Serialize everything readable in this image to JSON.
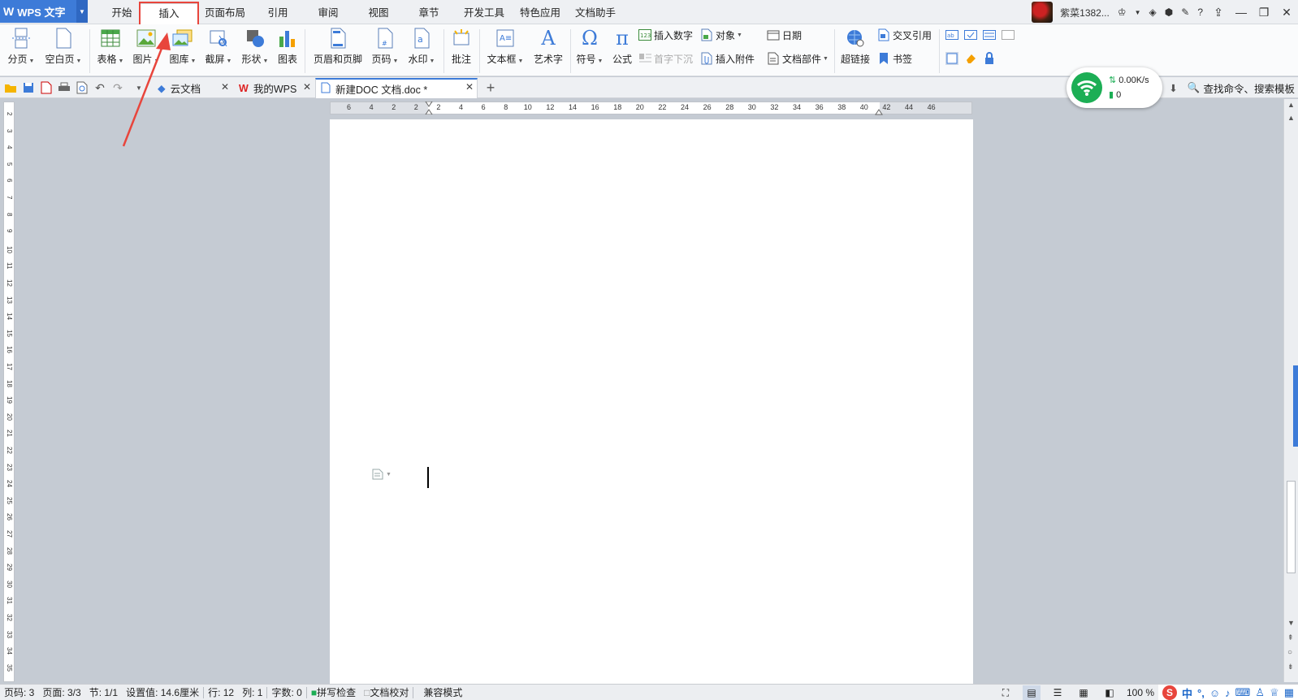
{
  "app": {
    "title": "WPS 文字",
    "logo": "W"
  },
  "menu": {
    "tabs": [
      "开始",
      "插入",
      "页面布局",
      "引用",
      "审阅",
      "视图",
      "章节",
      "开发工具",
      "特色应用",
      "文档助手"
    ],
    "active_tab": "插入"
  },
  "user": {
    "name": "紫菜1382..."
  },
  "ribbon": {
    "page_break": "分页",
    "blank_page": "空白页",
    "table": "表格",
    "picture": "图片",
    "gallery": "图库",
    "screenshot": "截屏",
    "shape": "形状",
    "chart": "图表",
    "header_footer": "页眉和页脚",
    "page_number": "页码",
    "watermark": "水印",
    "comment": "批注",
    "textbox": "文本框",
    "wordart": "艺术字",
    "symbol": "符号",
    "formula": "公式",
    "insert_number": "插入数字",
    "drop_cap": "首字下沉",
    "object": "对象",
    "attachment": "插入附件",
    "date": "日期",
    "doc_parts": "文档部件",
    "hyperlink": "超链接",
    "cross_ref": "交叉引用",
    "bookmark": "书签"
  },
  "doc_tabs": {
    "cloud": "云文档",
    "mywps": "我的WPS",
    "current": "新建DOC 文档.doc *"
  },
  "search": {
    "label": "查找命令、搜索模板"
  },
  "network": {
    "speed": "0.00K/s",
    "count": "0"
  },
  "ruler": {
    "h_marks": [
      "6",
      "4",
      "2",
      "2",
      "2",
      "4",
      "6",
      "8",
      "10",
      "12",
      "14",
      "16",
      "18",
      "20",
      "22",
      "24",
      "26",
      "28",
      "30",
      "32",
      "34",
      "36",
      "38",
      "40",
      "42",
      "44",
      "46"
    ],
    "v_marks": [
      "2",
      "3",
      "4",
      "5",
      "6",
      "7",
      "8",
      "9",
      "10",
      "11",
      "12",
      "13",
      "14",
      "15",
      "16",
      "17",
      "18",
      "19",
      "20",
      "21",
      "22",
      "23",
      "24",
      "25",
      "26",
      "27",
      "28",
      "29",
      "30",
      "31",
      "32",
      "33",
      "34",
      "35"
    ]
  },
  "status": {
    "page": "页码: 3",
    "pages": "页面: 3/3",
    "section": "节: 1/1",
    "setting": "设置值: 14.6厘米",
    "row": "行: 12",
    "col": "列: 1",
    "words": "字数: 0",
    "spell": "拼写检查",
    "proof": "文档校对",
    "compat": "兼容模式",
    "zoom": "100 %"
  },
  "ime": {
    "mode": "中"
  },
  "colors": {
    "accent": "#3d7bd8",
    "annotation": "#e8453c",
    "wifi": "#1cae55"
  }
}
